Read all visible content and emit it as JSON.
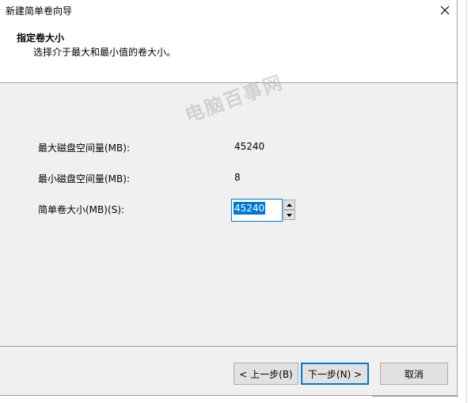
{
  "window": {
    "title": "新建简单卷向导"
  },
  "header": {
    "title": "指定卷大小",
    "subtitle": "选择介于最大和最小值的卷大小。"
  },
  "watermark": "电脑百事网",
  "fields": {
    "max_label": "最大磁盘空间量(MB):",
    "max_value": "45240",
    "min_label": "最小磁盘空间量(MB):",
    "min_value": "8",
    "size_label": "简单卷大小(MB)(S):",
    "size_value": "45240"
  },
  "buttons": {
    "back": "< 上一步(B)",
    "next": "下一步(N) >",
    "cancel": "取消"
  },
  "colors": {
    "accent": "#0078d7",
    "background": "#f0f0f0"
  }
}
